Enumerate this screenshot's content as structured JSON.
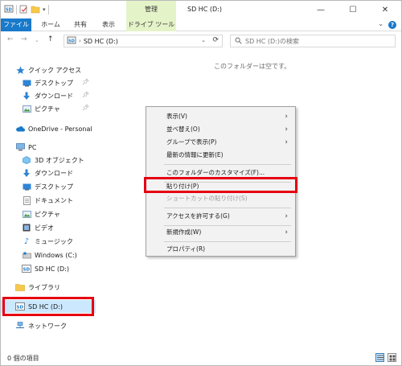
{
  "titlebar": {
    "manage_tab": "管理",
    "title": "SD HC (D:)",
    "minimize": "—",
    "maximize": "☐",
    "close": "✕"
  },
  "ribbon": {
    "tabs": [
      "ファイル",
      "ホーム",
      "共有",
      "表示",
      "ドライブ ツール"
    ],
    "help": "?"
  },
  "address": {
    "path": "SD HC (D:)",
    "search_placeholder": "SD HC (D:)の検索"
  },
  "nav_items": {
    "quick_access": "クイック アクセス",
    "desktop_qa": "デスクトップ",
    "downloads_qa": "ダウンロード",
    "pictures_qa": "ピクチャ",
    "onedrive": "OneDrive - Personal",
    "pc": "PC",
    "objects3d": "3D オブジェクト",
    "downloads": "ダウンロード",
    "desktop": "デスクトップ",
    "documents": "ドキュメント",
    "pictures": "ピクチャ",
    "videos": "ビデオ",
    "music": "ミュージック",
    "windows_c": "Windows (C:)",
    "sdhc_pc": "SD HC (D:)",
    "libraries": "ライブラリ",
    "sdhc": "SD HC (D:)",
    "network": "ネットワーク"
  },
  "content": {
    "empty_message": "このフォルダーは空です。"
  },
  "context_menu": {
    "view": "表示(V)",
    "sort": "並べ替え(O)",
    "group": "グループで表示(P)",
    "refresh": "最新の情報に更新(E)",
    "customize": "このフォルダーのカスタマイズ(F)...",
    "paste": "貼り付け(P)",
    "paste_shortcut": "ショートカットの貼り付け(S)",
    "give_access": "アクセスを許可する(G)",
    "new": "新規作成(W)",
    "properties": "プロパティ(R)"
  },
  "status": {
    "items": "0 個の項目"
  },
  "colors": {
    "accent": "#1979ca",
    "highlight": "#e60012",
    "drive_tools": "#e5f3c8"
  }
}
